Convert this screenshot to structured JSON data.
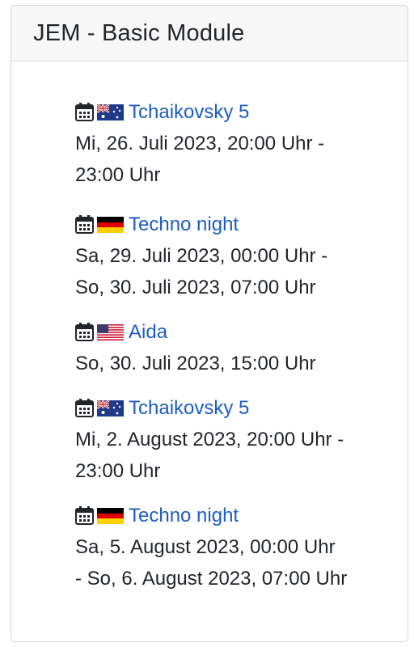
{
  "module": {
    "title": "JEM - Basic Module"
  },
  "events": [
    {
      "title": "Tchaikovsky 5",
      "flag": "australia-flag",
      "date_line1": "Mi, 26. Juli 2023, 20:00 Uhr -",
      "date_line2": "23:00 Uhr"
    },
    {
      "title": "Techno night",
      "flag": "germany-flag",
      "date_line1": "Sa, 29. Juli 2023, 00:00 Uhr -",
      "date_line2": "So, 30. Juli 2023, 07:00 Uhr"
    },
    {
      "title": "Aida",
      "flag": "usa-flag",
      "date_line1": "So, 30. Juli 2023, 15:00 Uhr",
      "date_line2": ""
    },
    {
      "title": "Tchaikovsky 5",
      "flag": "australia-flag",
      "date_line1": "Mi, 2. August 2023, 20:00 Uhr -",
      "date_line2": "23:00 Uhr"
    },
    {
      "title": "Techno night",
      "flag": "germany-flag",
      "date_line1": "Sa, 5. August 2023, 00:00 Uhr",
      "date_line2": "- So, 6. August 2023, 07:00 Uhr"
    }
  ],
  "colors": {
    "link": "#1b5ec2",
    "text": "#212529",
    "header_bg": "#f7f7f7",
    "border": "#d6d6d6"
  }
}
